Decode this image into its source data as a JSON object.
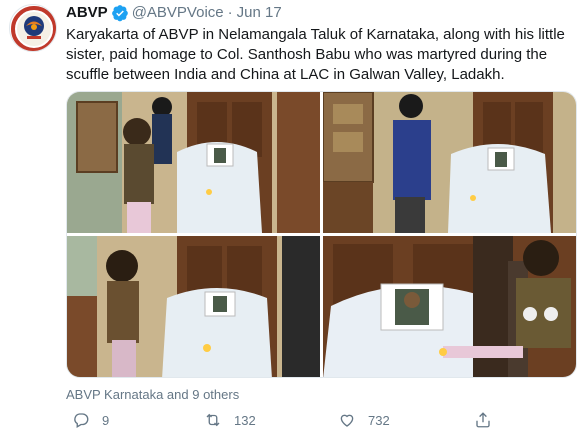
{
  "tweet": {
    "author_name": "ABVP",
    "author_handle": "@ABVPVoice",
    "separator": "·",
    "date": "Jun 17",
    "verified": true,
    "text": "Karyakarta of ABVP in Nelamangala Taluk of Karnataka, along with his little sister, paid homage to Col. Santhosh Babu who was martyred during the scuffle between India and China at LAC in Galwan Valley, Ladakh.",
    "tagged": "ABVP Karnataka and 9 others",
    "photo_count": 4,
    "actions": {
      "reply_count": "9",
      "retweet_count": "132",
      "like_count": "732"
    }
  },
  "icons": {
    "verified": "verified-badge-icon",
    "reply": "reply-icon",
    "retweet": "retweet-icon",
    "like": "heart-icon",
    "share": "share-icon"
  },
  "colors": {
    "accent": "#1da1f2",
    "text": "#14171a",
    "muted": "#657786",
    "border": "#e1e8ed"
  }
}
